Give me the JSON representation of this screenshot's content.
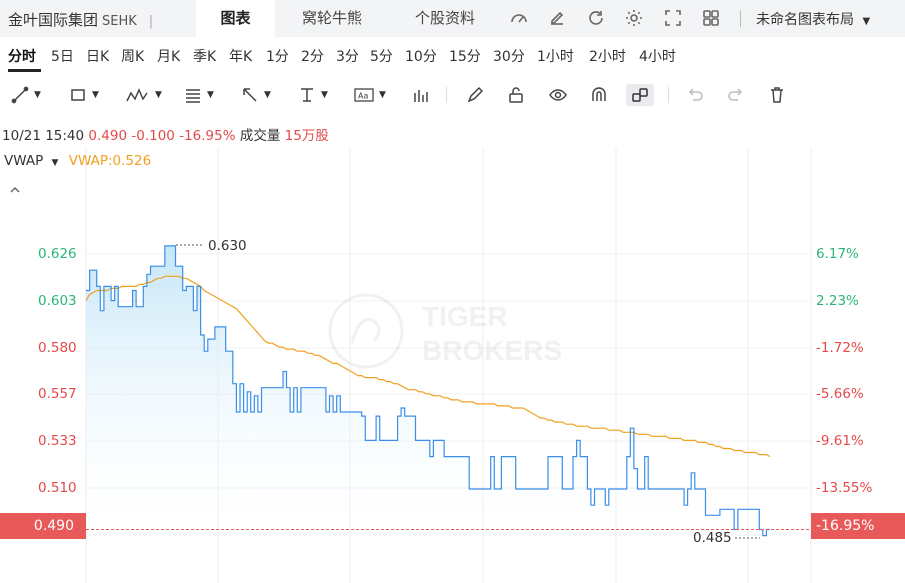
{
  "header": {
    "stock_name": "金叶国际集团",
    "exchange": "SEHK",
    "separator": "|",
    "tabs": [
      "图表",
      "窝轮牛熊",
      "个股资料"
    ],
    "active_tab": "图表",
    "layout_label": "未命名图表布局"
  },
  "periods": [
    "分时",
    "5日",
    "日K",
    "周K",
    "月K",
    "季K",
    "年K",
    "1分",
    "2分",
    "3分",
    "5分",
    "10分",
    "15分",
    "30分",
    "1小时",
    "2小时",
    "4小时"
  ],
  "active_period": "分时",
  "info": {
    "datetime": "10/21 15:40",
    "price": "0.490",
    "change": "-0.100",
    "change_pct": "-16.95%",
    "volume_label": "成交量",
    "volume": "15万股"
  },
  "indicator": {
    "name": "VWAP",
    "value_label": "VWAP:0.526"
  },
  "chart_data": {
    "type": "line",
    "y_left_ticks": [
      "0.626",
      "0.603",
      "0.580",
      "0.557",
      "0.533",
      "0.510"
    ],
    "y_right_ticks": [
      "6.17%",
      "2.23%",
      "-1.72%",
      "-5.66%",
      "-9.61%",
      "-13.55%"
    ],
    "current_price_label": "0.490",
    "current_pct_label": "-16.95%",
    "high_label": "0.630",
    "low_label": "0.485",
    "ylim": [
      0.478,
      0.64
    ],
    "series": [
      {
        "name": "",
        "color": "#3b8fe8",
        "values": [
          0.608,
          0.618,
          0.618,
          0.61,
          0.598,
          0.61,
          0.61,
          0.603,
          0.61,
          0.6,
          0.6,
          0.6,
          0.6,
          0.608,
          0.6,
          0.6,
          0.61,
          0.616,
          0.62,
          0.62,
          0.62,
          0.62,
          0.63,
          0.63,
          0.63,
          0.62,
          0.62,
          0.608,
          0.61,
          0.61,
          0.598,
          0.61,
          0.586,
          0.578,
          0.584,
          0.584,
          0.59,
          0.59,
          0.59,
          0.578,
          0.578,
          0.562,
          0.548,
          0.562,
          0.548,
          0.558,
          0.548,
          0.556,
          0.548,
          0.56,
          0.56,
          0.56,
          0.56,
          0.56,
          0.56,
          0.568,
          0.56,
          0.548,
          0.56,
          0.548,
          0.56,
          0.56,
          0.56,
          0.56,
          0.56,
          0.56,
          0.56,
          0.548,
          0.556,
          0.548,
          0.556,
          0.548,
          0.548,
          0.548,
          0.548,
          0.548,
          0.548,
          0.546,
          0.534,
          0.534,
          0.534,
          0.546,
          0.534,
          0.534,
          0.534,
          0.534,
          0.534,
          0.546,
          0.55,
          0.546,
          0.546,
          0.546,
          0.534,
          0.534,
          0.534,
          0.534,
          0.526,
          0.534,
          0.534,
          0.534,
          0.526,
          0.526,
          0.526,
          0.526,
          0.526,
          0.526,
          0.526,
          0.51,
          0.51,
          0.51,
          0.51,
          0.51,
          0.51,
          0.526,
          0.51,
          0.51,
          0.526,
          0.526,
          0.526,
          0.526,
          0.51,
          0.51,
          0.51,
          0.51,
          0.51,
          0.51,
          0.51,
          0.51,
          0.51,
          0.526,
          0.526,
          0.526,
          0.526,
          0.51,
          0.51,
          0.51,
          0.526,
          0.534,
          0.526,
          0.526,
          0.51,
          0.502,
          0.51,
          0.51,
          0.51,
          0.502,
          0.51,
          0.51,
          0.51,
          0.51,
          0.51,
          0.526,
          0.54,
          0.52,
          0.51,
          0.51,
          0.526,
          0.51,
          0.51,
          0.51,
          0.51,
          0.51,
          0.51,
          0.51,
          0.51,
          0.51,
          0.51,
          0.502,
          0.51,
          0.518,
          0.51,
          0.51,
          0.51,
          0.497,
          0.497,
          0.497,
          0.497,
          0.5,
          0.5,
          0.5,
          0.5,
          0.49,
          0.5,
          0.5,
          0.5,
          0.5,
          0.5,
          0.5,
          0.49,
          0.487,
          0.49,
          0.49
        ]
      },
      {
        "name": "VWAP",
        "color": "#f0a020",
        "values": [
          0.603,
          0.606,
          0.607,
          0.608,
          0.608,
          0.608,
          0.608,
          0.609,
          0.609,
          0.609,
          0.61,
          0.61,
          0.61,
          0.61,
          0.61,
          0.611,
          0.611,
          0.612,
          0.612,
          0.613,
          0.614,
          0.614,
          0.615,
          0.615,
          0.615,
          0.615,
          0.615,
          0.614,
          0.614,
          0.613,
          0.612,
          0.611,
          0.61,
          0.608,
          0.607,
          0.606,
          0.605,
          0.604,
          0.603,
          0.602,
          0.601,
          0.6,
          0.599,
          0.597,
          0.595,
          0.593,
          0.591,
          0.589,
          0.587,
          0.585,
          0.583,
          0.582,
          0.582,
          0.581,
          0.58,
          0.58,
          0.579,
          0.579,
          0.579,
          0.578,
          0.578,
          0.578,
          0.577,
          0.577,
          0.576,
          0.576,
          0.575,
          0.574,
          0.573,
          0.572,
          0.572,
          0.571,
          0.57,
          0.569,
          0.568,
          0.567,
          0.566,
          0.566,
          0.565,
          0.565,
          0.565,
          0.565,
          0.564,
          0.564,
          0.563,
          0.563,
          0.562,
          0.562,
          0.561,
          0.56,
          0.559,
          0.559,
          0.559,
          0.558,
          0.558,
          0.557,
          0.557,
          0.556,
          0.556,
          0.556,
          0.555,
          0.555,
          0.554,
          0.554,
          0.554,
          0.553,
          0.553,
          0.553,
          0.553,
          0.552,
          0.552,
          0.552,
          0.552,
          0.552,
          0.552,
          0.551,
          0.551,
          0.551,
          0.551,
          0.55,
          0.55,
          0.55,
          0.55,
          0.549,
          0.548,
          0.547,
          0.546,
          0.545,
          0.545,
          0.544,
          0.544,
          0.543,
          0.543,
          0.543,
          0.542,
          0.542,
          0.542,
          0.541,
          0.541,
          0.541,
          0.541,
          0.54,
          0.54,
          0.54,
          0.54,
          0.54,
          0.539,
          0.539,
          0.539,
          0.539,
          0.538,
          0.538,
          0.538,
          0.538,
          0.537,
          0.537,
          0.537,
          0.537,
          0.536,
          0.536,
          0.536,
          0.536,
          0.536,
          0.535,
          0.535,
          0.535,
          0.535,
          0.534,
          0.534,
          0.534,
          0.534,
          0.533,
          0.533,
          0.533,
          0.532,
          0.532,
          0.531,
          0.531,
          0.53,
          0.53,
          0.53,
          0.529,
          0.529,
          0.529,
          0.528,
          0.528,
          0.528,
          0.528,
          0.527,
          0.527,
          0.527,
          0.526
        ]
      }
    ],
    "reference_line": 0.49,
    "grid": true,
    "legend": "top-left"
  },
  "watermark": {
    "line1": "TIGER",
    "line2": "BROKERS"
  },
  "colors": {
    "up": "#2db57a",
    "down": "#e44a4a",
    "price_line": "#3b8fe8",
    "vwap": "#f0a020",
    "ref_tag": "#e85a5a"
  }
}
